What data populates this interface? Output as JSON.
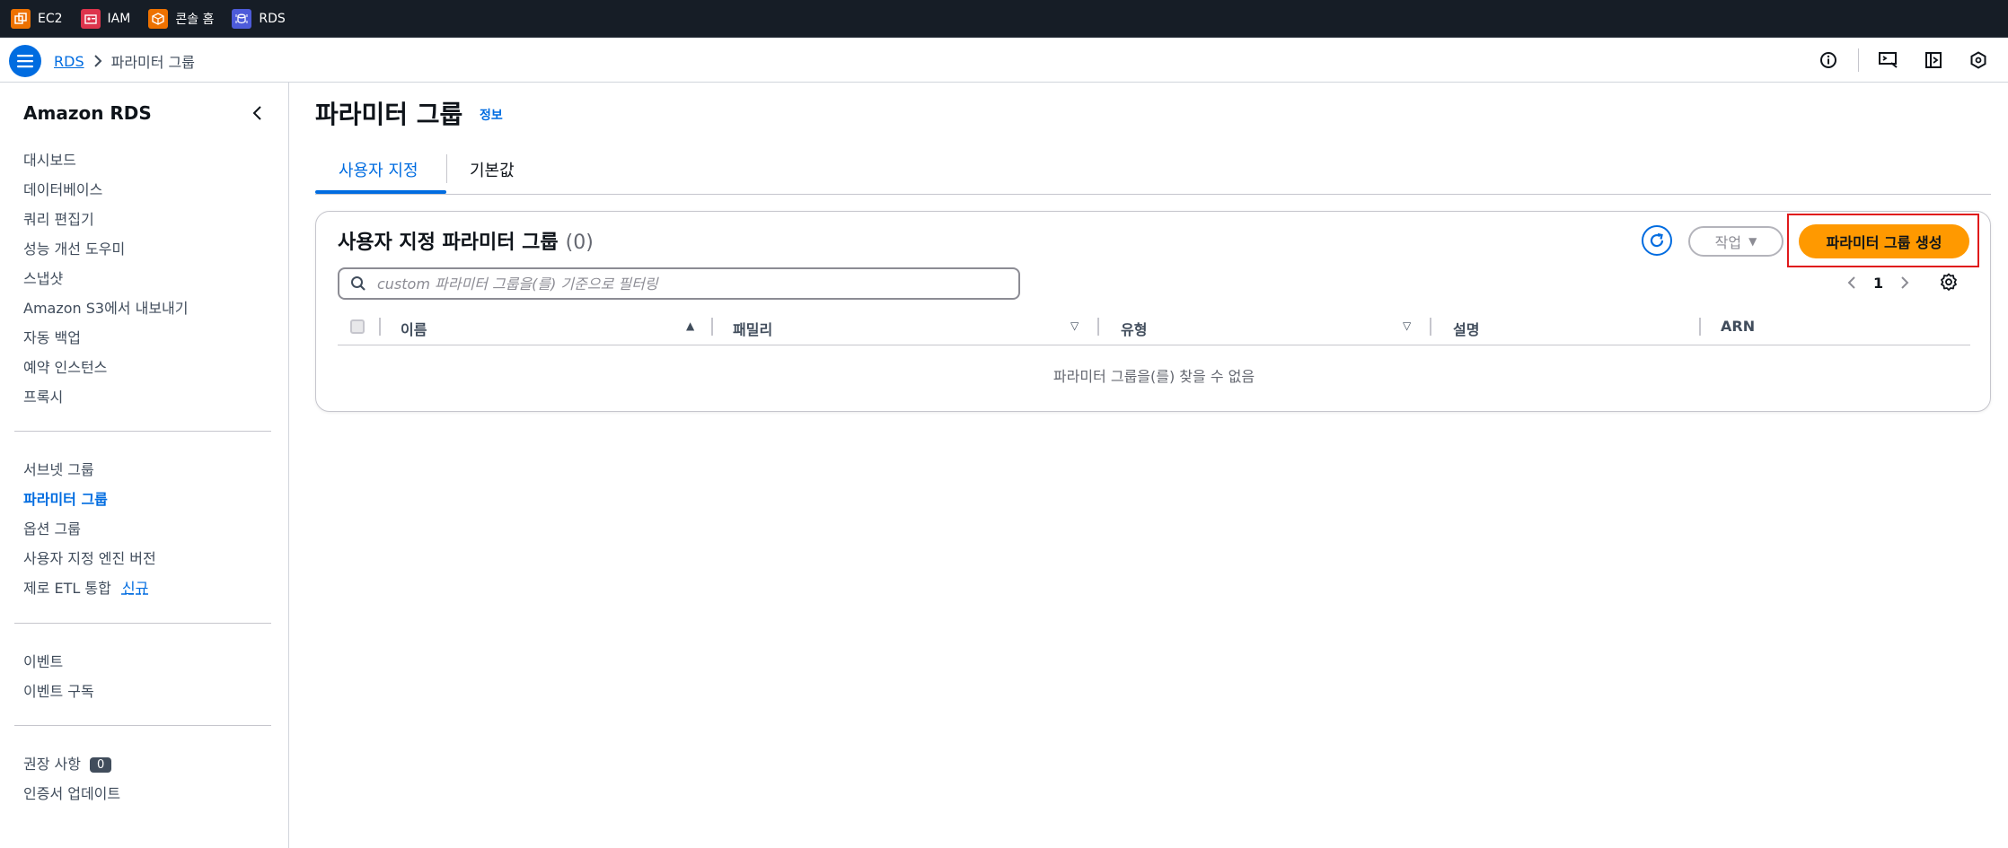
{
  "services": [
    {
      "label": "EC2",
      "color": "#ed7100",
      "icon": "ec2-icon"
    },
    {
      "label": "IAM",
      "color": "#dd344c",
      "icon": "iam-icon"
    },
    {
      "label": "콘솔 홈",
      "color": "#ed7100",
      "icon": "console-home-icon"
    },
    {
      "label": "RDS",
      "color": "#4d5bd9",
      "icon": "rds-icon"
    }
  ],
  "breadcrumb": {
    "root": "RDS",
    "current": "파라미터 그룹"
  },
  "sidebar": {
    "title": "Amazon RDS",
    "section1": [
      "대시보드",
      "데이터베이스",
      "쿼리 편집기",
      "성능 개선 도우미",
      "스냅샷",
      "Amazon S3에서 내보내기",
      "자동 백업",
      "예약 인스턴스",
      "프록시"
    ],
    "section2": [
      "서브넷 그룹",
      "파라미터 그룹",
      "옵션 그룹",
      "사용자 지정 엔진 버전"
    ],
    "zero_etl": "제로 ETL 통합",
    "new_badge": "신규",
    "section3": [
      "이벤트",
      "이벤트 구독"
    ],
    "recommendations": "권장 사항",
    "recommendations_count": "0",
    "certificate_update": "인증서 업데이트"
  },
  "page": {
    "title": "파라미터 그룹",
    "info": "정보"
  },
  "tabs": [
    "사용자 지정",
    "기본값"
  ],
  "card": {
    "title": "사용자 지정 파라미터 그룹",
    "count": "(0)",
    "action_label": "작업",
    "create_label": "파라미터 그룹 생성",
    "search_placeholder": "custom 파라미터 그룹을(를) 기준으로 필터링",
    "page_number": "1",
    "columns": [
      "이름",
      "패밀리",
      "유형",
      "설명",
      "ARN"
    ],
    "empty_message": "파라미터 그룹을(를) 찾을 수 없음"
  }
}
